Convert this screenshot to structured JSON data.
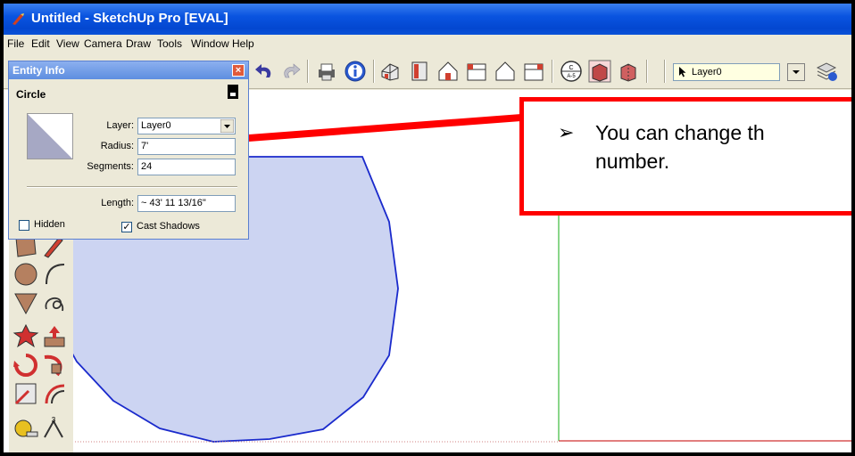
{
  "window": {
    "title": "Untitled - SketchUp Pro [EVAL]"
  },
  "menu": [
    "File",
    "Edit",
    "View",
    "Camera",
    "Draw",
    "Tools",
    "Window",
    "Help"
  ],
  "toolbar": {
    "layer_value": "Layer0",
    "icons": [
      "undo-icon",
      "redo-icon",
      "print-icon",
      "model-info-icon",
      "iso-view-icon",
      "top-view-icon",
      "front-view-icon",
      "right-view-icon",
      "back-view-icon",
      "left-view-icon",
      "section-plane-icon",
      "xray-icon",
      "back-edges-icon",
      "layer-manager-icon"
    ]
  },
  "entity_info": {
    "panel_title": "Entity Info",
    "close_glyph": "×",
    "entity_type": "Circle",
    "layer_label": "Layer:",
    "layer_value": "Layer0",
    "radius_label": "Radius:",
    "radius_value": "7'",
    "segments_label": "Segments:",
    "segments_value": "24",
    "length_label": "Length:",
    "length_value": "~ 43' 11 13/16\"",
    "hidden_label": "Hidden",
    "hidden_checked": false,
    "cast_shadows_label": "Cast Shadows",
    "cast_shadows_checked": true,
    "check_glyph": "✓"
  },
  "callout": {
    "bullet": "➢",
    "line1": "You can change th",
    "line2": "number."
  },
  "colors": {
    "circle_fill": "#ccd4f2",
    "circle_stroke": "#1a2acc",
    "callout_border": "#ff0000",
    "green_axis": "#4cc04c",
    "red_axis": "#d03030"
  }
}
